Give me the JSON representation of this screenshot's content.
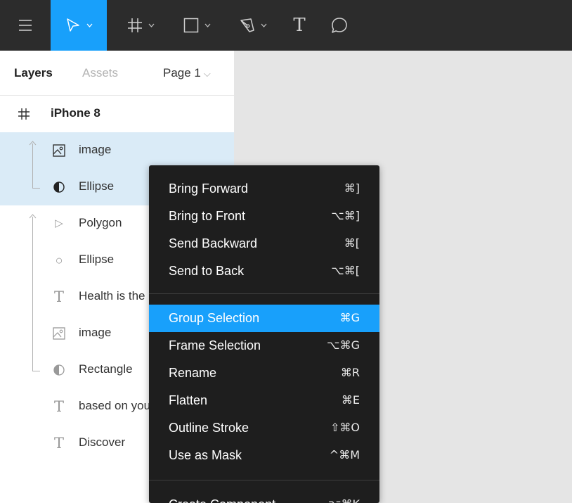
{
  "toolbar": {
    "tools": [
      {
        "name": "menu",
        "icon": "hamburger-icon"
      },
      {
        "name": "move",
        "icon": "move-icon",
        "active": true
      },
      {
        "name": "frame",
        "icon": "frame-icon"
      },
      {
        "name": "shape",
        "icon": "rectangle-icon"
      },
      {
        "name": "pen",
        "icon": "pen-icon"
      },
      {
        "name": "text",
        "icon": "text-icon",
        "glyph": "T"
      },
      {
        "name": "comment",
        "icon": "comment-icon"
      }
    ],
    "accent": "#18a0fb",
    "background": "#2c2c2c"
  },
  "panel": {
    "tabs": {
      "layers": "Layers",
      "assets": "Assets",
      "page": "Page 1",
      "page_chevron": "⌵"
    },
    "layers": [
      {
        "label": "iPhone 8",
        "icon": "frame-icon",
        "glyph": "#",
        "selected": false
      },
      {
        "label": "image",
        "icon": "image-icon",
        "glyph": "",
        "selected": true
      },
      {
        "label": "Ellipse",
        "icon": "half-circle-mask-icon",
        "glyph": "",
        "selected": true
      },
      {
        "label": "Polygon",
        "icon": "polygon-icon",
        "glyph": "▷",
        "selected": false
      },
      {
        "label": "Ellipse",
        "icon": "ellipse-icon",
        "glyph": "○",
        "selected": false
      },
      {
        "label": "Health is the",
        "icon": "text-icon",
        "glyph": "T",
        "selected": false
      },
      {
        "label": "image",
        "icon": "image-icon",
        "glyph": "",
        "selected": false
      },
      {
        "label": "Rectangle",
        "icon": "half-circle-mask-icon",
        "glyph": "",
        "selected": false
      },
      {
        "label": "based on your",
        "icon": "text-icon",
        "glyph": "T",
        "selected": false
      },
      {
        "label": "Discover",
        "icon": "text-icon",
        "glyph": "T",
        "selected": false
      }
    ],
    "selection_color": "#daebf7"
  },
  "context_menu": {
    "items": [
      {
        "label": "Bring Forward",
        "shortcut": "⌘]"
      },
      {
        "label": "Bring to Front",
        "shortcut": "⌥⌘]"
      },
      {
        "label": "Send Backward",
        "shortcut": "⌘["
      },
      {
        "label": "Send to Back",
        "shortcut": "⌥⌘["
      },
      {
        "label": "Group Selection",
        "shortcut": "⌘G",
        "highlighted": true
      },
      {
        "label": "Frame Selection",
        "shortcut": "⌥⌘G"
      },
      {
        "label": "Rename",
        "shortcut": "⌘R"
      },
      {
        "label": "Flatten",
        "shortcut": "⌘E"
      },
      {
        "label": "Outline Stroke",
        "shortcut": "⇧⌘O"
      },
      {
        "label": "Use as Mask",
        "shortcut": "^⌘M"
      },
      {
        "label": "Create Component",
        "shortcut": "⌥⌘K"
      }
    ],
    "background": "#1e1e1e",
    "highlight_color": "#18a0fb"
  }
}
